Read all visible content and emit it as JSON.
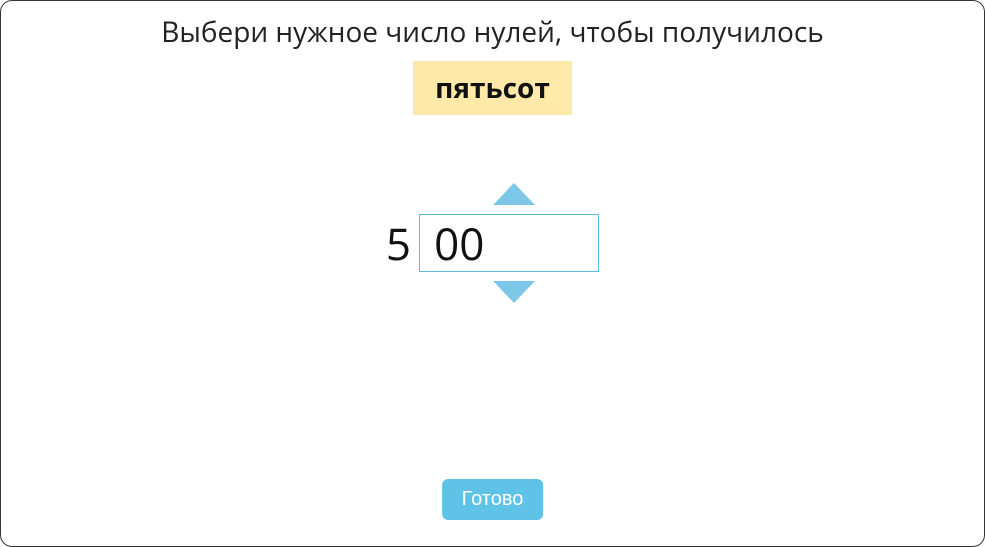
{
  "instruction": "Выбери нужное число нулей, чтобы получилось",
  "target_word": "пятьсот",
  "fixed_digit": "5",
  "zeros_value": "00",
  "submit_label": "Готово"
}
